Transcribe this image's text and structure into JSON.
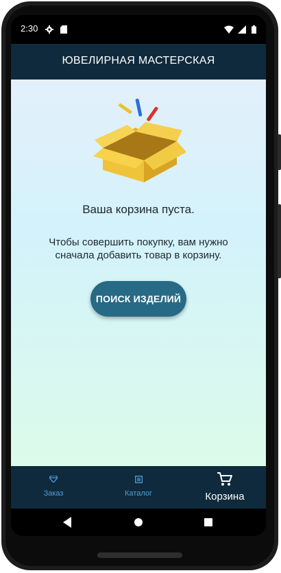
{
  "status_bar": {
    "time": "2:30",
    "left_icons": [
      "gear-icon",
      "sd-card-icon"
    ],
    "right_icons": [
      "wifi-icon",
      "signal-icon",
      "battery-icon"
    ]
  },
  "app_bar": {
    "title": "ЮВЕЛИРНАЯ МАСТЕРСКАЯ"
  },
  "empty_cart": {
    "illustration": "open-box-icon",
    "title": "Ваша корзина пуста.",
    "description": "Чтобы совершить покупку, вам нужно сначала добавить товар в корзину.",
    "button_label": "ПОИСК ИЗДЕЛИЙ"
  },
  "bottom_nav": {
    "items": [
      {
        "label": "Заказ",
        "icon": "diamond-icon",
        "active": false
      },
      {
        "label": "Каталог",
        "icon": "catalog-icon",
        "active": false
      },
      {
        "label": "Корзина",
        "icon": "cart-icon",
        "active": true
      }
    ]
  },
  "system_nav": {
    "buttons": [
      "back-icon",
      "home-icon",
      "recents-icon"
    ]
  },
  "colors": {
    "app_bar": "#0f2a3c",
    "button": "#276a86",
    "nav_inactive": "#4ea0d8",
    "nav_active": "#ffffff"
  }
}
